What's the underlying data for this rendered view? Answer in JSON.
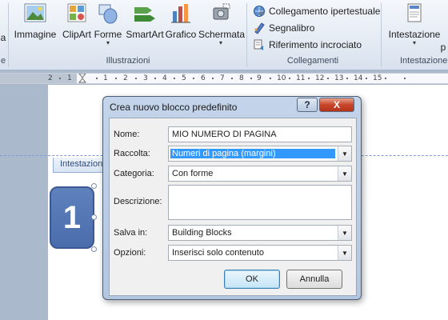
{
  "ribbon": {
    "partial_left_label": "a",
    "partial_group_label": "e",
    "buttons": {
      "immagine": "Immagine",
      "clipart": "ClipArt",
      "forme": "Forme",
      "smartart": "SmartArt",
      "grafico": "Grafico",
      "schermata": "Schermata",
      "intestazione": "Intestazione",
      "partial_right": "p"
    },
    "groups": {
      "illustrazioni": "Illustrazioni",
      "collegamenti": "Collegamenti",
      "intestazione_partial": "Intestazione"
    },
    "links": {
      "collegamento": "Collegamento ipertestuale",
      "segnalibro": "Segnalibro",
      "riferimento": "Riferimento incrociato"
    }
  },
  "ruler": {
    "ticks": [
      "2",
      "1",
      "1",
      "2",
      "3",
      "4",
      "5",
      "6",
      "7",
      "8",
      "9",
      "10",
      "11",
      "12",
      "13",
      "14",
      "15"
    ]
  },
  "document": {
    "header_tag": "Intestazione",
    "page_number": "1"
  },
  "dialog": {
    "title": "Crea nuovo blocco predefinito",
    "help_glyph": "?",
    "close_glyph": "X",
    "fields": {
      "nome": {
        "label": "Nome:",
        "value": "MIO NUMERO DI PAGINA"
      },
      "raccolta": {
        "label": "Raccolta:",
        "value": "Numeri di pagina (margini)"
      },
      "categoria": {
        "label": "Categoria:",
        "value": "Con forme"
      },
      "descrizione": {
        "label": "Descrizione:",
        "value": ""
      },
      "salva_in": {
        "label": "Salva in:",
        "value": "Building Blocks"
      },
      "opzioni": {
        "label": "Opzioni:",
        "value": "Inserisci solo contenuto"
      }
    },
    "ok_label": "OK",
    "cancel_label": "Annulla"
  },
  "colors": {
    "selection": "#3399ff",
    "page_number_box": "#4f74b3",
    "close_button": "#c7462b",
    "header_dash": "#7a9bd3"
  }
}
